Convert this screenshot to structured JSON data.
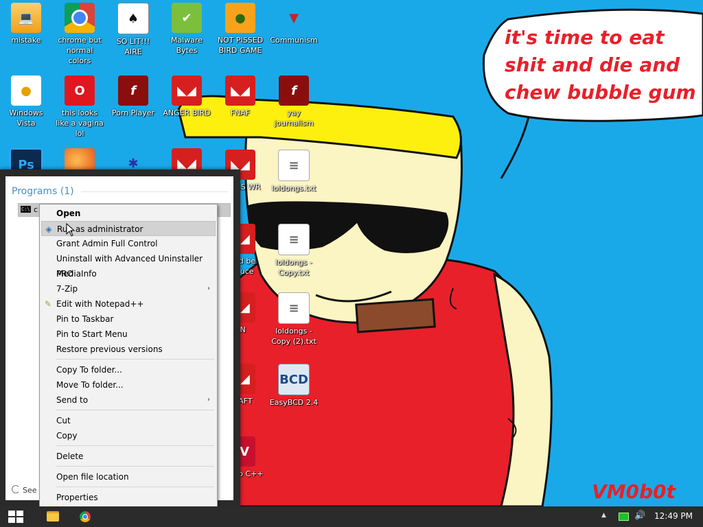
{
  "desktop": {
    "icons": [
      {
        "label": "mistake",
        "glyph": "💻",
        "icon": "mistake-icon",
        "cls": "g-mistake"
      },
      {
        "label": "chrome but normal colors",
        "glyph": "",
        "icon": "chrome-icon",
        "cls": "g-chrome"
      },
      {
        "label": "SO LIT!!! AIRE",
        "glyph": "♠",
        "icon": "solitaire-icon",
        "cls": "g-cards"
      },
      {
        "label": "Malware Bytes",
        "glyph": "✔",
        "icon": "malwarebytes-shield-icon",
        "cls": "g-shield"
      },
      {
        "label": "NOT PISSED BIRD GAME",
        "glyph": "●",
        "icon": "green-pig-icon",
        "cls": "g-pig"
      },
      {
        "label": "Communism",
        "glyph": "▼",
        "icon": "communism-emblem-icon",
        "cls": "g-commie"
      },
      {
        "label": "Windows Vista",
        "glyph": "●",
        "icon": "egg-icon",
        "cls": "g-egg"
      },
      {
        "label": "this looks like a vagina lol",
        "glyph": "O",
        "icon": "opera-icon",
        "cls": "g-opera"
      },
      {
        "label": "Porn Player",
        "glyph": "f",
        "icon": "flash-player-icon",
        "cls": "g-flash"
      },
      {
        "label": "ANGER BIRD",
        "glyph": "◣◢",
        "icon": "angry-bird-icon",
        "cls": "g-bird"
      },
      {
        "label": "FNAF",
        "glyph": "◣◢",
        "icon": "angry-bird-icon-2",
        "cls": "g-bird"
      },
      {
        "label": "yay journalism",
        "glyph": "f",
        "icon": "flash-player-icon-2",
        "cls": "g-flash"
      },
      {
        "label": "",
        "glyph": "Ps",
        "icon": "photoshop-icon",
        "cls": "g-ps"
      },
      {
        "label": "",
        "glyph": "",
        "icon": "firefox-icon",
        "cls": "g-firefox"
      },
      {
        "label": "",
        "glyph": "✱",
        "icon": "spider-solitaire-icon",
        "cls": "g-spider"
      },
      {
        "label": "",
        "glyph": "◣◢",
        "icon": "angry-bird-hat-icon",
        "cls": "g-bird"
      },
      {
        "label": "SAURS WR",
        "glyph": "◣◢",
        "icon": "angry-bird-icon-3",
        "cls": "g-bird"
      },
      {
        "label": "loldongs.txt",
        "glyph": "≡",
        "icon": "text-file-icon",
        "cls": "g-txt"
      },
      {
        "label": "build be esauce",
        "glyph": "◣◢",
        "icon": "angry-bird-icon-4",
        "cls": "g-bird"
      },
      {
        "label": "loldongs - Copy.txt",
        "glyph": "≡",
        "icon": "text-file-icon-2",
        "cls": "g-txt"
      },
      {
        "label": "AN",
        "glyph": "◣◢",
        "icon": "angry-bird-icon-5",
        "cls": "g-bird"
      },
      {
        "label": "loldongs - Copy (2).txt",
        "glyph": "≡",
        "icon": "text-file-icon-3",
        "cls": "g-txt"
      },
      {
        "label": "CRAFT",
        "glyph": "◣◢",
        "icon": "angry-bird-icon-6",
        "cls": "g-bird"
      },
      {
        "label": "EasyBCD 2.4",
        "glyph": "BCD",
        "icon": "easybcd-icon",
        "cls": "g-easy"
      },
      {
        "label": "cadero C++",
        "glyph": "EV",
        "icon": "embarcadero-dev-icon",
        "cls": "g-dev"
      }
    ],
    "speech_bubble_text": "it's time to eat shit and die and chew bubble gum",
    "signature": "VM0b0t"
  },
  "start_menu": {
    "programs_heading": "Programs (1)",
    "result_label": "c",
    "see_more": "See"
  },
  "context_menu": {
    "items": {
      "open": "Open",
      "run_as_admin": "Run as administrator",
      "grant_admin": "Grant Admin Full Control",
      "uninstall": "Uninstall with Advanced Uninstaller PRO",
      "mediainfo": "MediaInfo",
      "zip": "7-Zip",
      "notepad": "Edit with Notepad++",
      "pin_taskbar": "Pin to Taskbar",
      "pin_start": "Pin to Start Menu",
      "restore": "Restore previous versions",
      "copy_to": "Copy To folder...",
      "move_to": "Move To folder...",
      "send_to": "Send to",
      "cut": "Cut",
      "copy": "Copy",
      "delete": "Delete",
      "open_location": "Open file location",
      "properties": "Properties"
    },
    "arrow_glyph": "›"
  },
  "taskbar": {
    "clock": "12:49 PM",
    "tray_up_glyph": "▲",
    "volume_glyph": "🔊"
  },
  "colors": {
    "desktop_bg": "#1aa9e8",
    "taskbar_bg": "#2b2b2b",
    "menu_bg": "#f2f2f2",
    "menu_highlight": "#d2d2d2",
    "cartoon_red": "#e8202a",
    "cartoon_yellow": "#fdf00f"
  }
}
